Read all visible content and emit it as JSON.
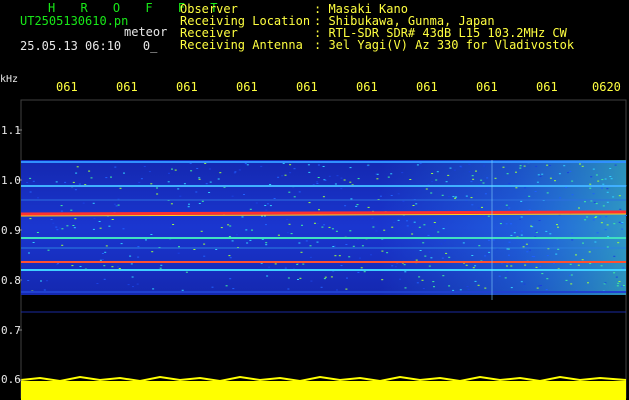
{
  "header": {
    "brand": "H R O F F T",
    "filename": "UT2505130610.pn",
    "meteor_label": "meteor",
    "datetime": "25.05.13 06:10",
    "datetime_suffix": "0_",
    "info": [
      {
        "label": "Observer",
        "value": ": Masaki Kano"
      },
      {
        "label": "Receiving Location",
        "value": ": Shibukawa, Gunma, Japan"
      },
      {
        "label": "Receiver",
        "value": ": RTL-SDR SDR# 43dB L15 103.2MHz CW"
      },
      {
        "label": "Receiving Antenna",
        "value": ": 3el Yagi(V) Az 330 for Vladivostok"
      }
    ]
  },
  "axes": {
    "y_unit": "kHz",
    "y_ticks": [
      "1.1",
      "1.0",
      "0.9",
      "0.8",
      "0.7",
      "0.6"
    ],
    "x_ticks": [
      "061",
      "061",
      "061",
      "061",
      "061",
      "061",
      "061",
      "061",
      "061",
      "0620"
    ]
  },
  "colors": {
    "text_green": "#18e818",
    "text_yellow": "#ffff40",
    "background": "#000000",
    "signal_band": "#1020c0",
    "echo_line": "#ff3030",
    "noise_floor": "#ffff00"
  }
}
